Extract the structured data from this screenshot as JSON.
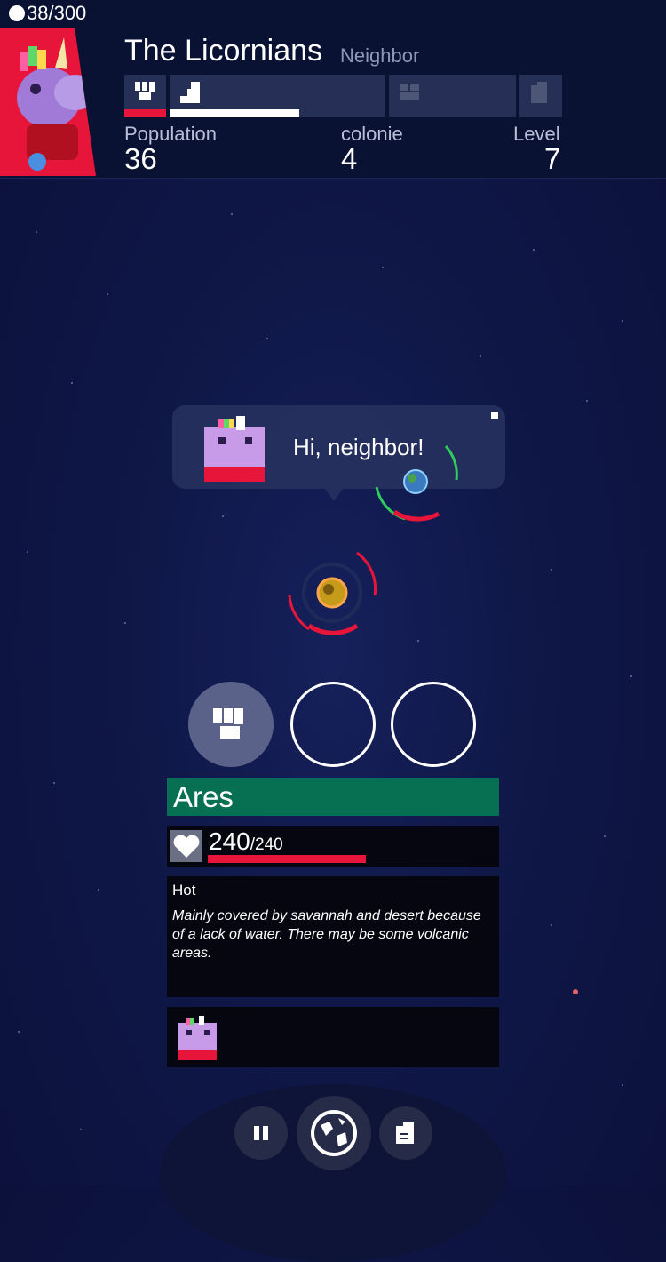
{
  "hud": {
    "coins": "38/300",
    "civ_name": "The Licornians",
    "relation": "Neighbor",
    "stats": [
      {
        "label": "Population",
        "value": "36"
      },
      {
        "label": "colonie",
        "value": "4"
      },
      {
        "label": "Level",
        "value": "7"
      }
    ],
    "tabs": [
      {
        "icon": "fist-icon",
        "progress": 1.0,
        "bar_color": "#e8153a"
      },
      {
        "icon": "build-icon",
        "progress": 0.6,
        "bar_color": "#ffffff"
      },
      {
        "icon": "research-icon",
        "progress": 0,
        "bar_color": ""
      },
      {
        "icon": "document-icon",
        "progress": 0,
        "bar_color": ""
      }
    ]
  },
  "dialog": {
    "message": "Hi, neighbor!"
  },
  "planet_panel": {
    "name": "Ares",
    "hp": "240",
    "hp_max": "/240",
    "hp_fraction": 1.0,
    "climate": "Hot",
    "description": "Mainly covered by savannah and desert because of a lack of water. There may be some volcanic areas."
  },
  "colors": {
    "accent_red": "#e8153a",
    "panel_green": "#087052",
    "space_bg": "#0f1747"
  },
  "dock": {
    "buttons": [
      "pause-icon",
      "globe-icon",
      "notes-icon"
    ]
  }
}
